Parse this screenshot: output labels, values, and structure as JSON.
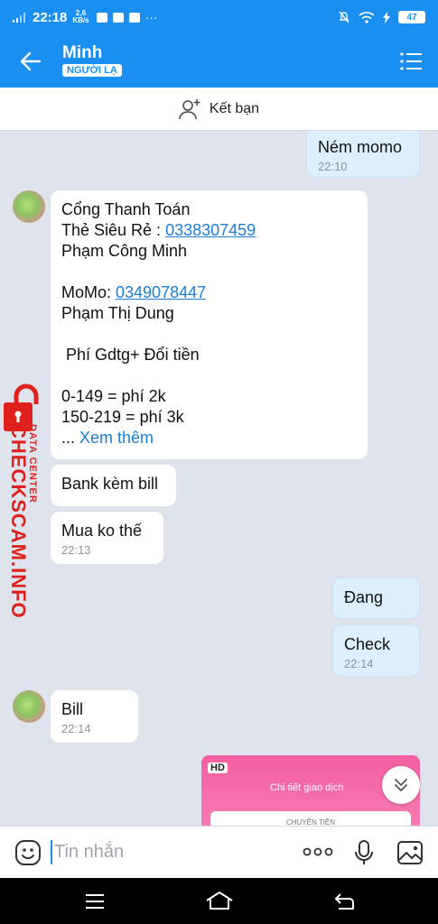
{
  "status_bar": {
    "time": "22:18",
    "speed_value": "2,6",
    "speed_unit": "KB/s",
    "battery": "47"
  },
  "header": {
    "contact_name": "Minh",
    "badge": "NGƯỜI LẠ"
  },
  "add_friend": {
    "label": "Kết bạn"
  },
  "messages": [
    {
      "dir": "out",
      "lines": [
        "Ném momo"
      ],
      "time": "22:10"
    },
    {
      "dir": "in",
      "lines": [
        "Cổng Thanh Toán"
      ],
      "line2_prefix": "Thẻ Siêu Rẻ : ",
      "line2_link": "0338307459",
      "line3": "Phạm Công Minh",
      "momo_prefix": "MoMo: ",
      "momo_link": "0349078447",
      "momo_name": "Phạm Thị Dung",
      "fee_line": " Phí Gdtg+ Đổi tiền",
      "fee1": "0-149 = phí 2k",
      "fee2": "150-219 = phí 3k",
      "more_prefix": "... ",
      "more_link": "Xem thêm"
    },
    {
      "dir": "in",
      "lines": [
        "Bank kèm bill"
      ]
    },
    {
      "dir": "in",
      "lines": [
        "Mua ko thế"
      ],
      "time": "22:13"
    },
    {
      "dir": "out",
      "lines": [
        "Đang"
      ]
    },
    {
      "dir": "out",
      "lines": [
        "Check"
      ],
      "time": "22:14"
    },
    {
      "dir": "in",
      "lines": [
        "Bill"
      ],
      "time": "22:14"
    }
  ],
  "image_message": {
    "hd": "HD",
    "title": "Chi tiết giao dịch",
    "card_text": "CHUYỂN TIỀN"
  },
  "watermark": {
    "main": "CHECKSCAM.INFO",
    "sub": "DATA CENTER"
  },
  "input": {
    "placeholder": "Tin nhắn"
  },
  "icons": [
    "back-arrow-icon",
    "menu-list-icon",
    "add-user-icon",
    "emoji-icon",
    "more-icon",
    "microphone-icon",
    "image-icon",
    "chevron-double-down-icon",
    "nav-menu-icon",
    "nav-home-icon",
    "nav-back-icon",
    "lock-icon"
  ]
}
